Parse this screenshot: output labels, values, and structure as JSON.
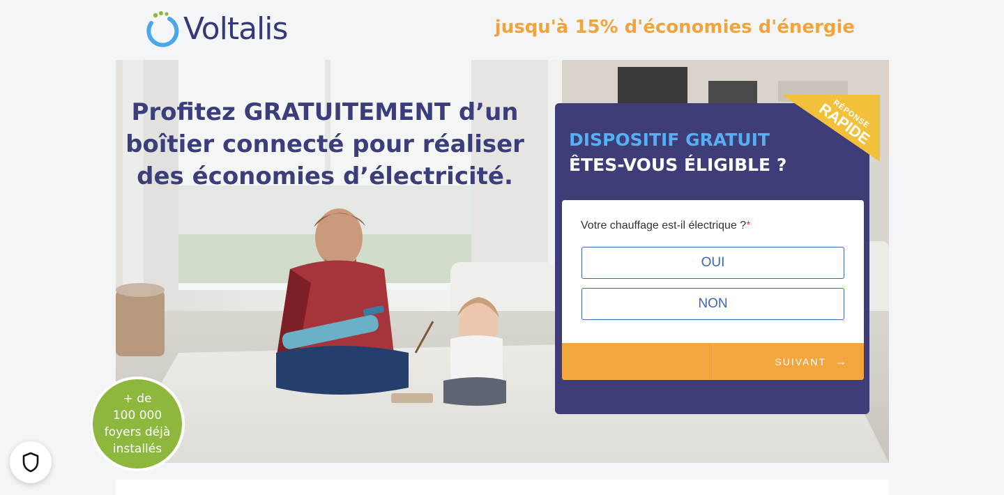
{
  "brand": {
    "name": "Voltalis",
    "tagline": "jusqu'à 15% d'économies d'énergie"
  },
  "hero": {
    "headline": [
      "Profitez GRATUITEMENT d’un",
      "boîtier connecté pour réaliser",
      "des économies d’électricité."
    ]
  },
  "form": {
    "ribbon_small": "RÉPONSE",
    "ribbon_big": "RAPIDE",
    "title1": "DISPOSITIF GRATUIT",
    "title2": "ÊTES-VOUS ÉLIGIBLE ?",
    "question": "Votre chauffage est-il électrique ?",
    "required_mark": "*",
    "answers": [
      "OUI",
      "NON"
    ],
    "next_label": "SUIVANT",
    "next_icon": "arrow-right-icon"
  },
  "badge": {
    "lines": [
      "+ de",
      "100 000",
      "foyers déjà",
      "installés"
    ]
  },
  "colors": {
    "brand_navy": "#343a79",
    "accent_orange": "#f0a43c",
    "panel_bg": "#3e3d78",
    "title_blue": "#56aff2",
    "ribbon_yellow": "#f2c03b",
    "button_blue": "#3a66b4",
    "badge_green": "#8db83d"
  },
  "icons": {
    "privacy": "shield-icon",
    "logo": "voltalis-ring-icon"
  }
}
